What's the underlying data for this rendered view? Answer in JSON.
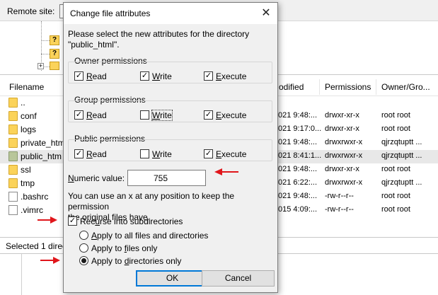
{
  "colors": {
    "accent": "#0078d7",
    "arrow": "#e0161b",
    "folder": "#fbd35a",
    "selected_row": "#e8e8e8"
  },
  "remote": {
    "label": "Remote site:"
  },
  "tree": {
    "unknown_icon_glyph": "?",
    "expander_glyph": "+"
  },
  "file_list": {
    "columns": [
      "Filename",
      "odified",
      "Permissions",
      "Owner/Gro..."
    ],
    "rows": [
      {
        "name": "..",
        "icon": "folder-icon",
        "modified": "",
        "permissions": "",
        "owner": "",
        "selected": false
      },
      {
        "name": "conf",
        "icon": "folder-icon",
        "modified": "021 9:48:...",
        "permissions": "drwxr-xr-x",
        "owner": "root root",
        "selected": false
      },
      {
        "name": "logs",
        "icon": "folder-icon",
        "modified": "021 9:17:0...",
        "permissions": "drwxr-xr-x",
        "owner": "root root",
        "selected": false
      },
      {
        "name": "private_htm",
        "icon": "folder-icon",
        "modified": "021 9:48:...",
        "permissions": "drwxrwxr-x",
        "owner": "qjrzqtuptt ...",
        "selected": false
      },
      {
        "name": "public_htm",
        "icon": "folder-link-icon",
        "modified": "021 8:41:1...",
        "permissions": "drwxrwxr-x",
        "owner": "qjrzqtuptt ...",
        "selected": true
      },
      {
        "name": "ssl",
        "icon": "folder-icon",
        "modified": "021 9:48:...",
        "permissions": "drwxr-xr-x",
        "owner": "root root",
        "selected": false
      },
      {
        "name": "tmp",
        "icon": "folder-icon",
        "modified": "021 6:22:...",
        "permissions": "drwxrwxr-x",
        "owner": "qjrzqtuptt ...",
        "selected": false
      },
      {
        "name": ".bashrc",
        "icon": "file-icon",
        "modified": "021 9:48:...",
        "permissions": "-rw-r--r--",
        "owner": "root root",
        "selected": false
      },
      {
        "name": ".vimrc",
        "icon": "file-icon",
        "modified": "015 4:09:...",
        "permissions": "-rw-r--r--",
        "owner": "root root",
        "selected": false
      }
    ]
  },
  "status": {
    "text": "Selected 1 direc"
  },
  "dialog": {
    "title": "Change file attributes",
    "close_glyph": "✕",
    "intro_line1": "Please select the new attributes for the directory",
    "intro_line2": "\"public_html\".",
    "groups": [
      {
        "title": "Owner permissions",
        "read": true,
        "write": true,
        "execute": true
      },
      {
        "title": "Group permissions",
        "read": true,
        "write": false,
        "execute": true
      },
      {
        "title": "Public permissions",
        "read": true,
        "write": false,
        "execute": true
      }
    ],
    "labels": {
      "read_u": "R",
      "read_rest": "ead",
      "write_u": "W",
      "write_rest": "rite",
      "execute_u": "E",
      "execute_rest": "xecute"
    },
    "numeric": {
      "label_u": "N",
      "label_rest": "umeric value:",
      "value": "755"
    },
    "hint_line1": "You can use an x at any position to keep the permission",
    "hint_line2": "the original files have.",
    "recurse": {
      "checked": true,
      "label_pre": "Rec",
      "label_u": "u",
      "label_post": "rse into subdirectories"
    },
    "apply_options": [
      {
        "pre": "",
        "u": "A",
        "post": "pply to all files and directories",
        "selected": false
      },
      {
        "pre": "Apply to ",
        "u": "f",
        "post": "iles only",
        "selected": false
      },
      {
        "pre": "Apply to ",
        "u": "d",
        "post": "irectories only",
        "selected": true
      }
    ],
    "ok_label": "OK",
    "cancel_label": "Cancel",
    "check_glyph": "✓"
  }
}
